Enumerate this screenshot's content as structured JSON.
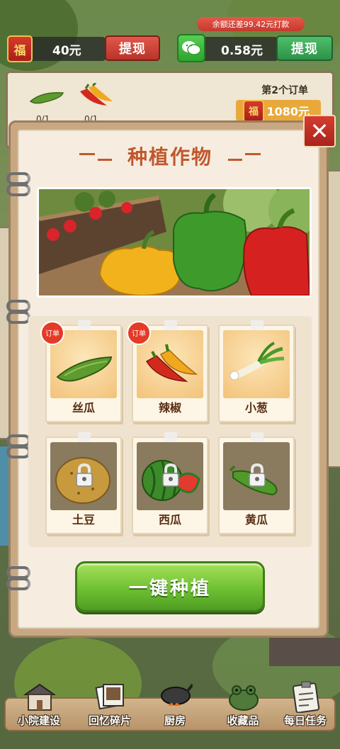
{
  "hud": {
    "coupon_amount": "40元",
    "coupon_withdraw_label": "提现",
    "coupon_icon_char": "福",
    "wechat_amount": "0.58元",
    "wechat_withdraw_label": "提现",
    "balance_tip": "余额还差99.42元打款"
  },
  "order_panel": {
    "order_label": "第2个订单",
    "reward_amount": "1080元",
    "reward_icon_char": "福",
    "item_counts": [
      "0/1",
      "0/1"
    ]
  },
  "dialog": {
    "title": "种植作物",
    "close_icon": "close-icon",
    "crops": [
      {
        "name": "丝瓜",
        "locked": false,
        "order": true,
        "icon": "loofah-icon"
      },
      {
        "name": "辣椒",
        "locked": false,
        "order": true,
        "icon": "chili-icon"
      },
      {
        "name": "小葱",
        "locked": false,
        "order": false,
        "icon": "scallion-icon"
      },
      {
        "name": "土豆",
        "locked": true,
        "order": false,
        "icon": "potato-icon"
      },
      {
        "name": "西瓜",
        "locked": true,
        "order": false,
        "icon": "watermelon-icon"
      },
      {
        "name": "黄瓜",
        "locked": true,
        "order": false,
        "icon": "cucumber-icon"
      }
    ],
    "order_badge_label": "订单",
    "plant_all_label": "一键种植"
  },
  "bottom_nav": [
    {
      "label": "小院建设",
      "icon": "house-icon"
    },
    {
      "label": "回忆碎片",
      "icon": "photos-icon"
    },
    {
      "label": "厨房",
      "icon": "wok-icon"
    },
    {
      "label": "收藏品",
      "icon": "frog-statue-icon"
    },
    {
      "label": "每日任务",
      "icon": "clipboard-icon"
    }
  ],
  "colors": {
    "title": "#c1582e",
    "plant_button": "#6fc033",
    "close_button": "#d63c31",
    "crop_name": "#5a2e14"
  }
}
